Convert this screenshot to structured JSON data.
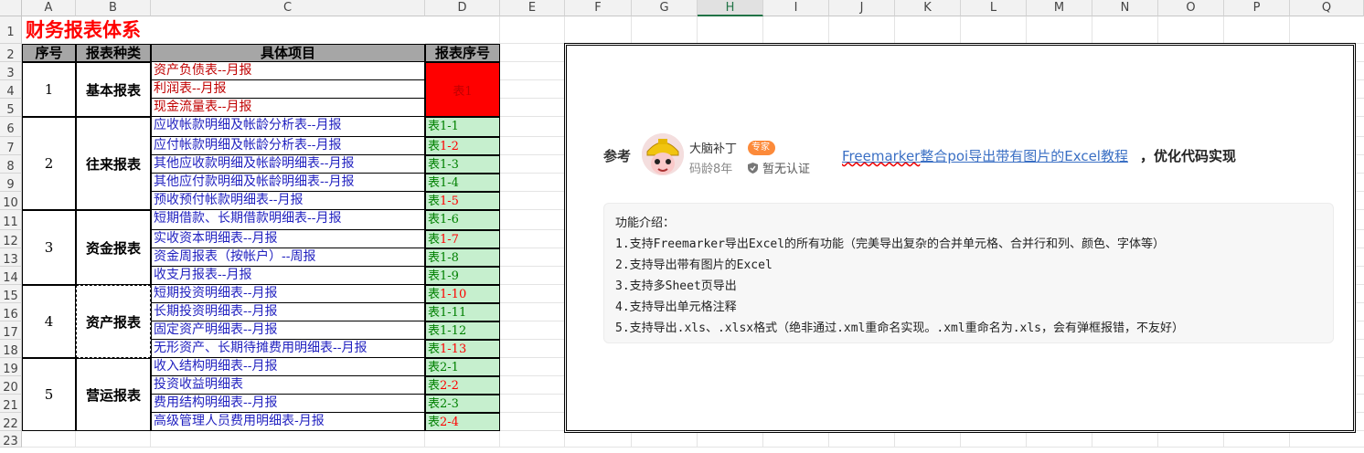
{
  "columns": [
    "A",
    "B",
    "C",
    "D",
    "E",
    "F",
    "G",
    "H",
    "I",
    "J",
    "K",
    "L",
    "M",
    "N",
    "O",
    "P",
    "Q"
  ],
  "selected_column": "H",
  "rows": [
    "1",
    "2",
    "3",
    "4",
    "5",
    "6",
    "7",
    "8",
    "9",
    "10",
    "11",
    "12",
    "13",
    "14",
    "15",
    "16",
    "17",
    "18",
    "19",
    "20",
    "21",
    "22",
    "23"
  ],
  "title": "财务报表体系",
  "headers": {
    "seq": "序号",
    "kind": "报表种类",
    "item": "具体项目",
    "code": "报表序号"
  },
  "groups": [
    {
      "seq": "1",
      "kind": "基本报表"
    },
    {
      "seq": "2",
      "kind": "往来报表"
    },
    {
      "seq": "3",
      "kind": "资金报表"
    },
    {
      "seq": "4",
      "kind": "资产报表"
    },
    {
      "seq": "5",
      "kind": "营运报表"
    }
  ],
  "items": [
    "资产负债表--月报",
    "利润表--月报",
    "现金流量表--月报",
    "应收帐款明细及帐龄分析表--月报",
    "应付帐款明细及帐龄分析表--月报",
    "其他应收款明细及帐龄明细表--月报",
    "其他应付款明细及帐龄明细表--月报",
    "预收预付帐款明细表--月报",
    "短期借款、长期借款明细表--月报",
    "实收资本明细表--月报",
    "资金周报表（按帐户）--周报",
    "收支月报表--月报",
    "短期投资明细表--月报",
    "长期投资明细表--月报",
    "固定资产明细表--月报",
    "无形资产、长期待摊费用明细表--月报",
    "收入结构明细表--月报",
    "投资收益明细表",
    "费用结构明细表--月报",
    "高级管理人员费用明细表-月报"
  ],
  "code_main": "表1",
  "codes": [
    {
      "p": "表",
      "s": "1-1"
    },
    {
      "p": "表",
      "s": "1-2"
    },
    {
      "p": "表",
      "s": "1-3"
    },
    {
      "p": "表",
      "s": "1-4"
    },
    {
      "p": "表",
      "s": "1-5"
    },
    {
      "p": "表",
      "s": "1-6"
    },
    {
      "p": "表",
      "s": "1-7"
    },
    {
      "p": "表",
      "s": "1-8"
    },
    {
      "p": "表",
      "s": "1-9"
    },
    {
      "p": "表",
      "s": "1-10"
    },
    {
      "p": "表",
      "s": "1-11"
    },
    {
      "p": "表",
      "s": "1-12"
    },
    {
      "p": "表",
      "s": "1-13"
    },
    {
      "p": "表",
      "s": "2-1"
    },
    {
      "p": "表",
      "s": "2-2"
    },
    {
      "p": "表",
      "s": "2-3"
    },
    {
      "p": "表",
      "s": "2-4"
    }
  ],
  "reference": {
    "label": "参考",
    "author": "大脑补丁",
    "badge": "专家",
    "age": "码龄8年",
    "cert": "暂无认证",
    "link_wavy": "Freemarker",
    "link_rest": "整合poi导出带有图片的Excel教程",
    "suffix": "，优化代码实现",
    "features": [
      "功能介绍：",
      "1.支持Freemarker导出Excel的所有功能（完美导出复杂的合并单元格、合并行和列、颜色、字体等）",
      "2.支持导出带有图片的Excel",
      "3.支持多Sheet页导出",
      "4.支持导出单元格注释",
      "5.支持导出.xls、.xlsx格式（绝非通过.xml重命名实现。.xml重命名为.xls，会有弹框报错，不友好）"
    ]
  },
  "colors": {
    "title": "#ff0000",
    "header_bg": "#a6a6a6",
    "code_bg": "#c6efce",
    "red_fill": "#ff0000",
    "blue_text": "#1f1fbf",
    "red_text": "#c00000"
  }
}
